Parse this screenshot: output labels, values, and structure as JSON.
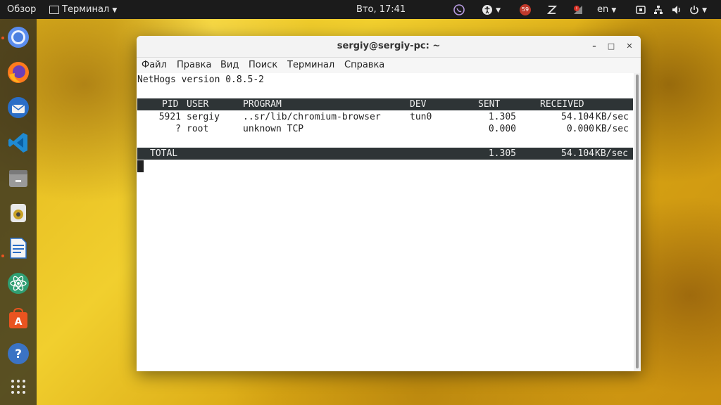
{
  "topbar": {
    "activities": "Обзор",
    "app_menu": "Терминал",
    "clock": "Вто, 17:41",
    "lang": "en",
    "notif_count": "59",
    "icons": [
      "terminal-app-icon",
      "viber-icon",
      "accessibility-icon",
      "notification-icon",
      "z-icon",
      "network-alert-icon",
      "screen-icon",
      "network-icon",
      "volume-icon",
      "power-icon"
    ]
  },
  "dock": {
    "items": [
      "chromium-icon",
      "firefox-icon",
      "thunderbird-icon",
      "vscode-icon",
      "files-icon",
      "rhythmbox-icon",
      "libreoffice-writer-icon",
      "atom-icon",
      "software-center-icon",
      "help-icon",
      "show-apps-icon"
    ]
  },
  "window": {
    "title": "sergiy@sergiy-pc: ~",
    "menu": [
      "Файл",
      "Правка",
      "Вид",
      "Поиск",
      "Терминал",
      "Справка"
    ]
  },
  "terminal": {
    "version_line": "NetHogs version 0.8.5-2",
    "headers": {
      "pid": "PID",
      "user": "USER",
      "program": "PROGRAM",
      "dev": "DEV",
      "sent": "SENT",
      "received": "RECEIVED"
    },
    "rows": [
      {
        "pid": "5921",
        "user": "sergiy",
        "program": "..sr/lib/chromium-browser",
        "dev": "tun0",
        "sent": "1.305",
        "received": "54.104",
        "unit": "KB/sec"
      },
      {
        "pid": "?",
        "user": "root",
        "program": "unknown TCP",
        "dev": "",
        "sent": "0.000",
        "received": "0.000",
        "unit": "KB/sec"
      }
    ],
    "total": {
      "label": "TOTAL",
      "sent": "1.305",
      "received": "54.104",
      "unit": "KB/sec"
    }
  },
  "colors": {
    "topbar": "#1b1b1b",
    "accent": "#e95420",
    "header_bg": "#2e3436"
  }
}
